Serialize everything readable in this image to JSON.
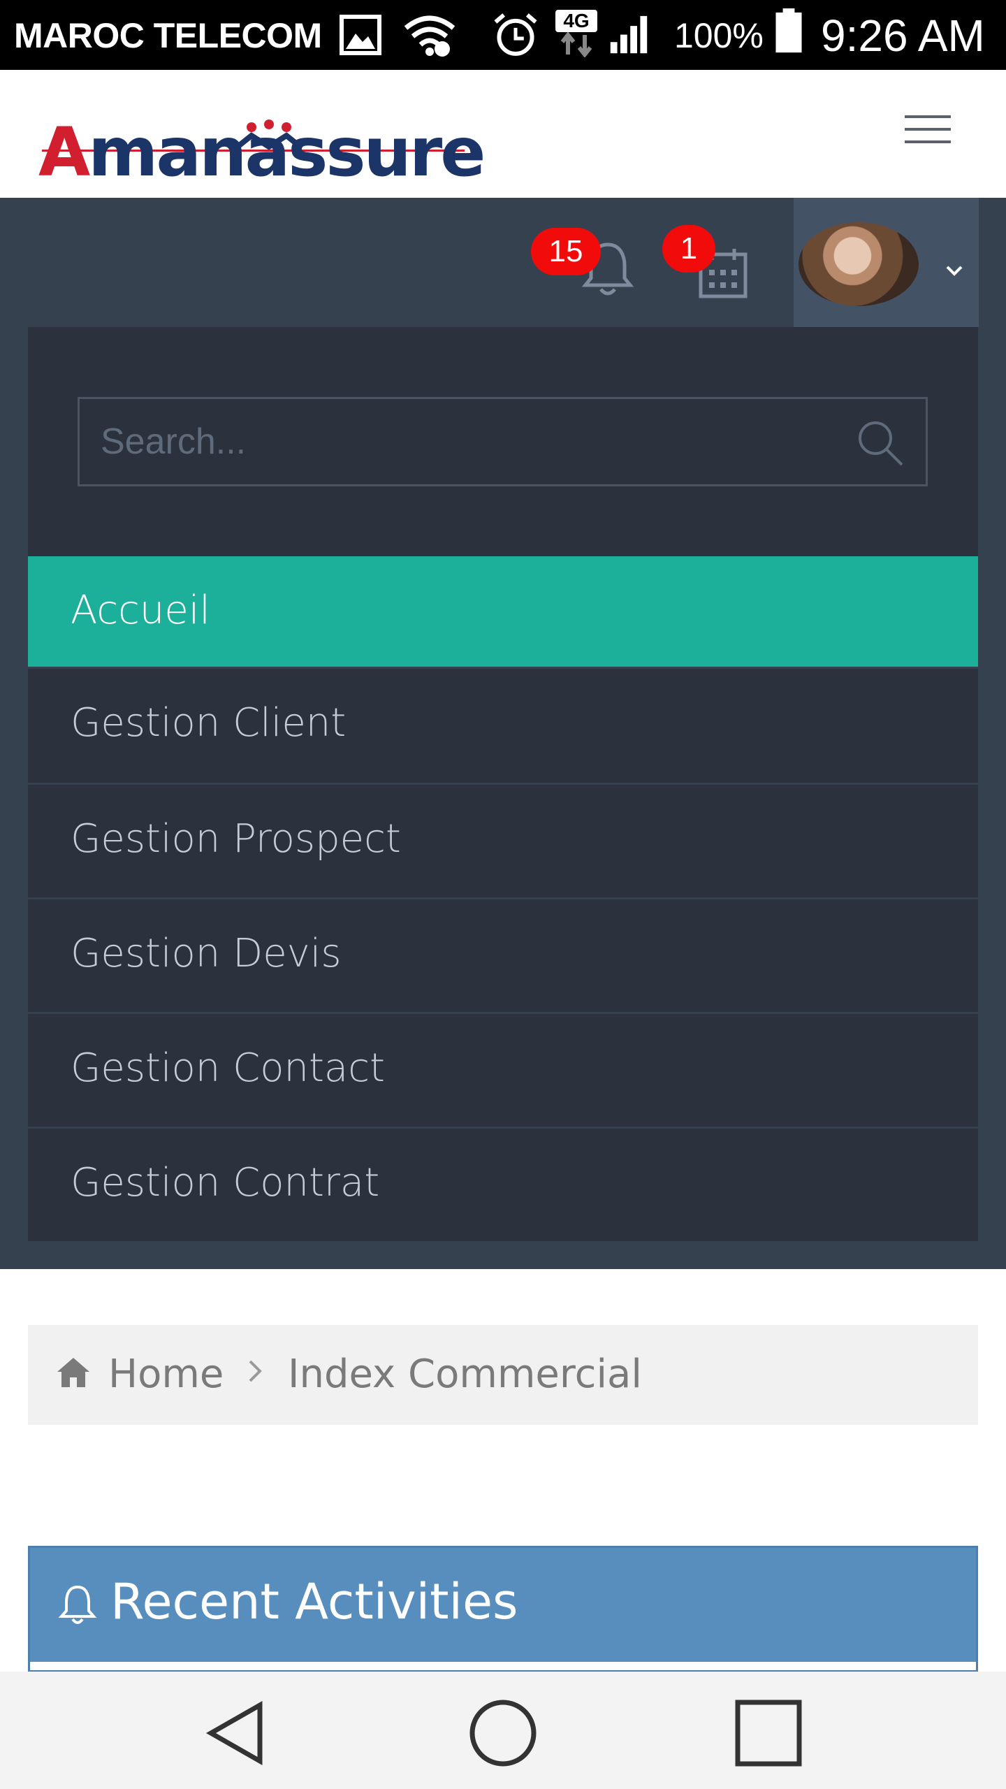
{
  "status_bar": {
    "carrier": "MAROC TELECOM",
    "network": "4G",
    "battery": "100%",
    "time": "9:26 AM",
    "icons": [
      "image-icon",
      "wifi-icon",
      "alarm-icon",
      "network-4g-icon",
      "signal-icon",
      "battery-icon"
    ]
  },
  "header": {
    "logo": {
      "text_a": "A",
      "text_rest": "manassure",
      "full": "Amanassure"
    },
    "menu_icon": "hamburger-icon"
  },
  "topbar": {
    "notifications_count": "15",
    "calendar_count": "1",
    "notifications_icon": "bell-icon",
    "calendar_icon": "calendar-icon",
    "user_menu_icon": "chevron-down-icon"
  },
  "sidebar": {
    "search_placeholder": "Search...",
    "items": [
      {
        "label": "Accueil",
        "active": true
      },
      {
        "label": "Gestion Client",
        "active": false
      },
      {
        "label": "Gestion Prospect",
        "active": false
      },
      {
        "label": "Gestion Devis",
        "active": false
      },
      {
        "label": "Gestion Contact",
        "active": false
      },
      {
        "label": "Gestion Contrat",
        "active": false
      }
    ]
  },
  "breadcrumb": {
    "home": "Home",
    "current": "Index Commercial"
  },
  "panel": {
    "title": "Recent Activities"
  },
  "colors": {
    "status_bar": "#000000",
    "topbar": "#364150",
    "sidebar": "#2b323e",
    "active_item": "#1caf9a",
    "badge": "#f20b0b",
    "panel": "#578ebe",
    "logo_red": "#d21f30",
    "logo_blue": "#1b3568"
  }
}
